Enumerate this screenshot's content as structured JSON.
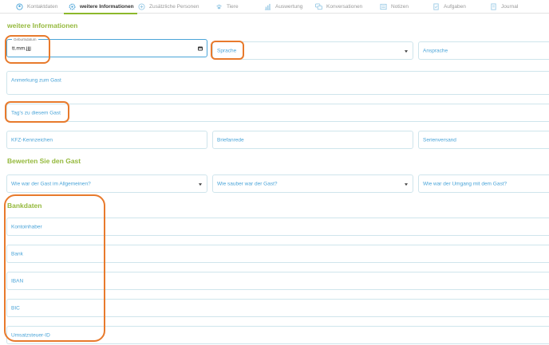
{
  "tabs": [
    {
      "label": "Kontaktdaten",
      "icon": "contact-icon",
      "active": false
    },
    {
      "label": "weitere Informationen",
      "icon": "gear-icon",
      "active": true
    },
    {
      "label": "Zusätzliche Personen",
      "icon": "add-person-icon",
      "active": false
    },
    {
      "label": "Tiere",
      "icon": "paw-icon",
      "active": false
    },
    {
      "label": "Auswertung",
      "icon": "chart-icon",
      "active": false
    },
    {
      "label": "Konversationen",
      "icon": "chat-icon",
      "active": false
    },
    {
      "label": "Notizen",
      "icon": "note-icon",
      "active": false
    },
    {
      "label": "Aufgaben",
      "icon": "task-icon",
      "active": false
    },
    {
      "label": "Journal",
      "icon": "journal-icon",
      "active": false
    }
  ],
  "weitere": {
    "heading": "weitere Informationen",
    "birthdate_label": "Geburtsdatum",
    "birthdate_value": "tt.mm.jjjj",
    "sprache": "Sprache",
    "ansprache": "Ansprache",
    "anmerkung": "Anmerkung zum Gast",
    "tags": "Tag's zu diesem Gast",
    "kfz": "KFZ-Kennzeichen",
    "briefanrede": "Briefanrede",
    "serienversand": "Serienversand"
  },
  "rating": {
    "heading": "Bewerten Sie den Gast",
    "general": "Wie war der Gast im Allgemeinen?",
    "cleanliness": "Wie sauber war der Gast?",
    "manner": "Wie war der Umgang mit dem Gast?"
  },
  "bank": {
    "heading": "Bankdaten",
    "kontoinhaber": "Kontoinhaber",
    "bank": "Bank",
    "iban": "IBAN",
    "bic": "BIC",
    "ust_id": "Umsatzsteuer-ID"
  },
  "colors": {
    "accent_green": "#95b93d",
    "field_label_blue": "#4aa4d8",
    "highlight_orange": "#e87a2c"
  }
}
